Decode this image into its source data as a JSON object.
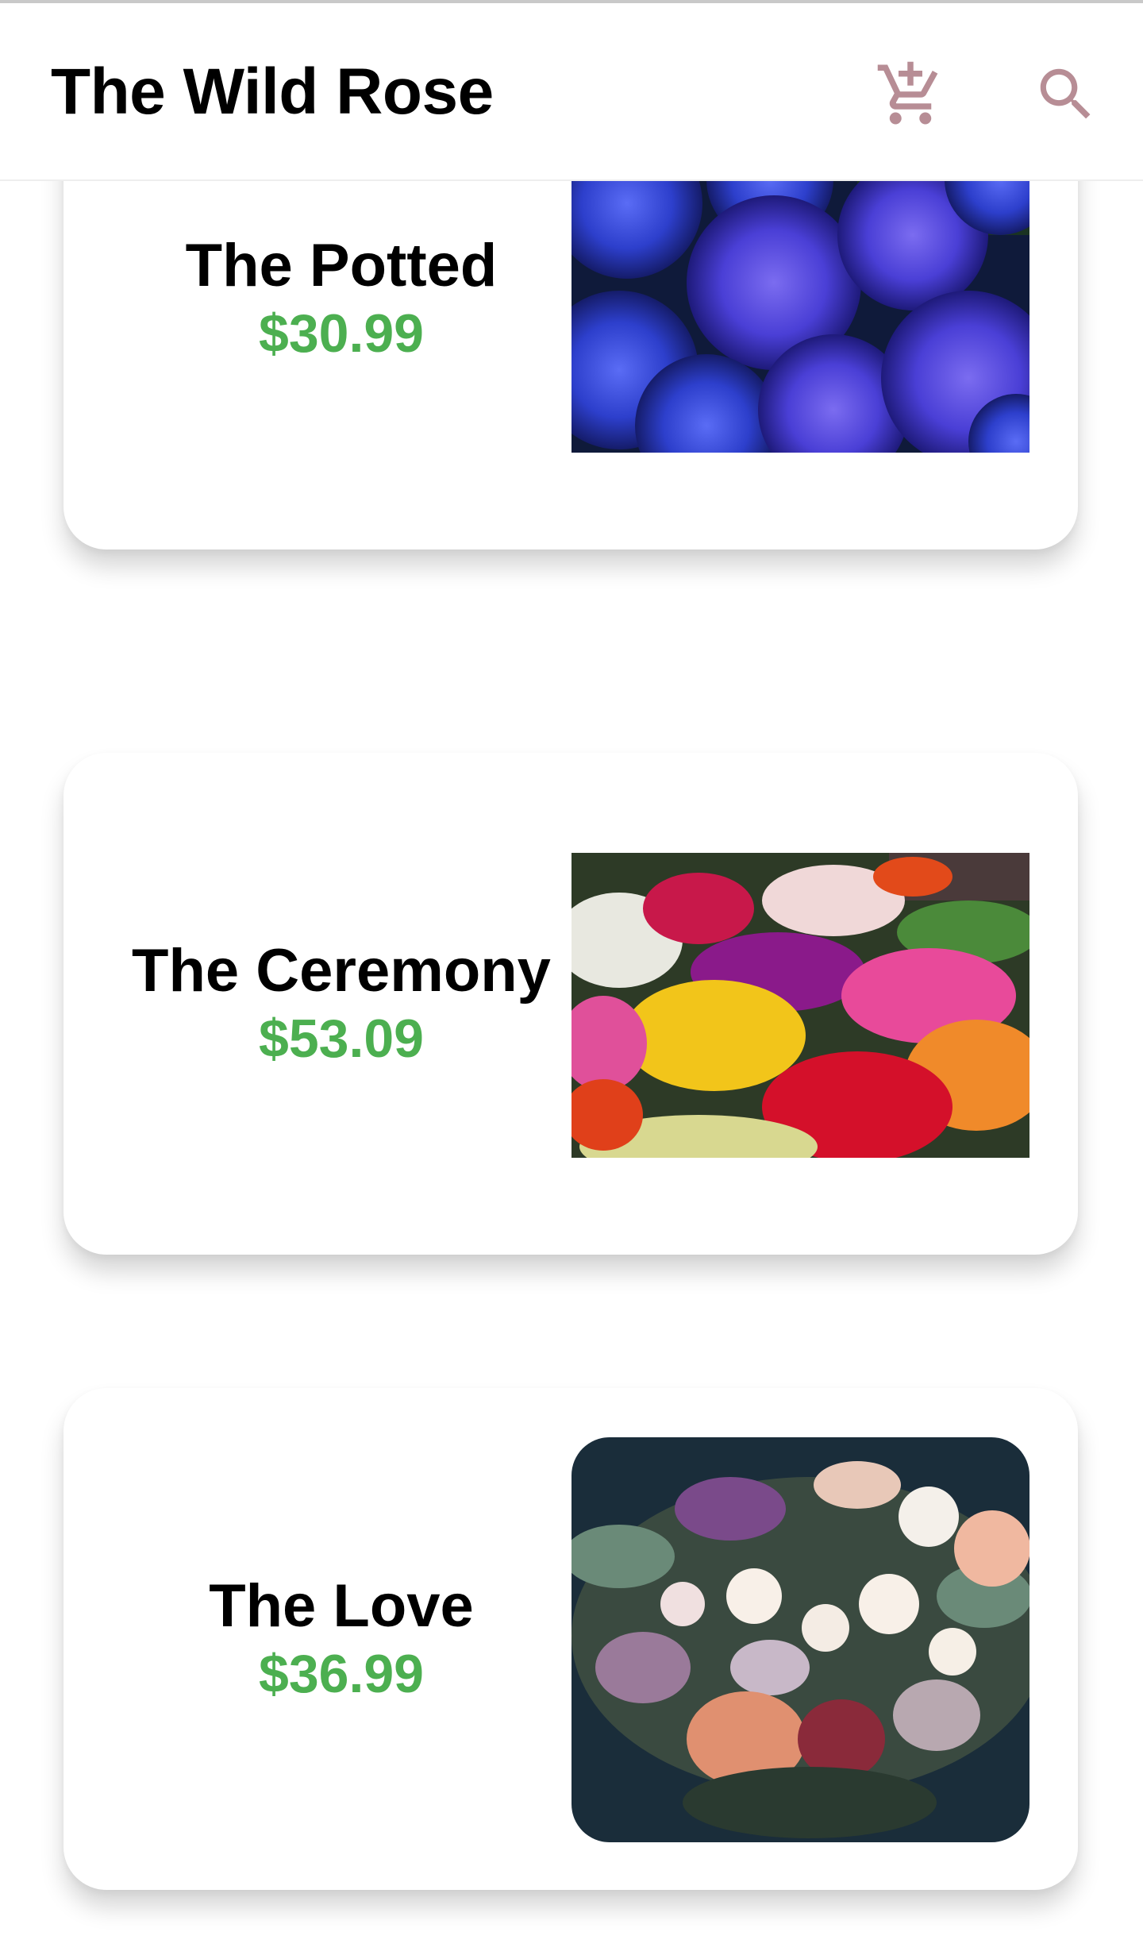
{
  "app_bar": {
    "title": "The Wild Rose",
    "cart_icon": "add-shopping-cart-icon",
    "search_icon": "search-icon",
    "icon_color": "#b78d95"
  },
  "products": [
    {
      "name": "The Potted",
      "price": "$30.99",
      "image": "blue-hydrangea-photo"
    },
    {
      "name": "The Ceremony",
      "price": "$53.09",
      "image": "tulip-market-photo"
    },
    {
      "name": "The Love",
      "price": "$36.99",
      "image": "rose-bouquet-photo"
    }
  ],
  "colors": {
    "price": "#4caf50",
    "title": "#000000",
    "background": "#ffffff"
  }
}
